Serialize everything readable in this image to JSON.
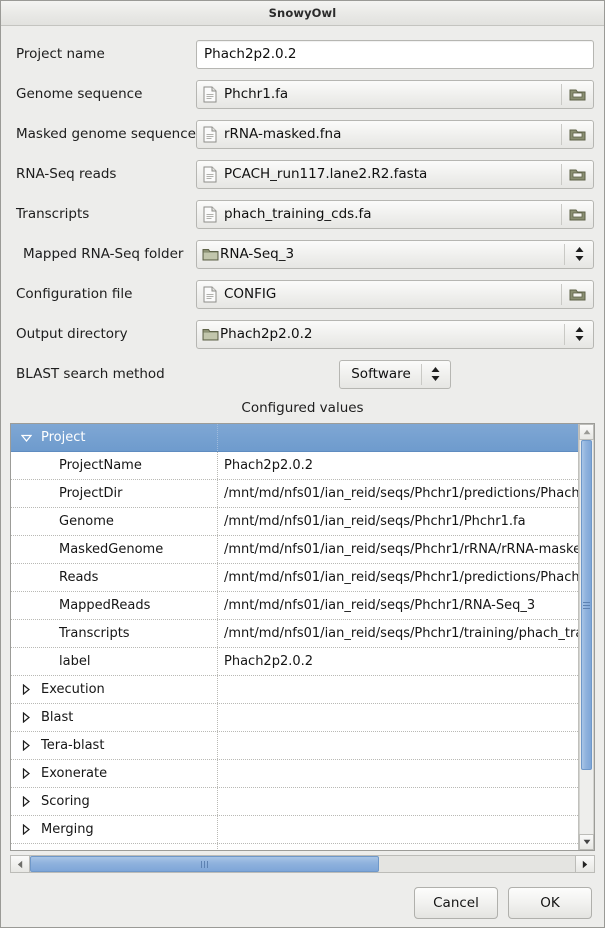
{
  "window": {
    "title": "SnowyOwl"
  },
  "form": {
    "rows": [
      {
        "label": "Project name",
        "type": "entry",
        "value": "Phach2p2.0.2",
        "icon": "",
        "name": "project-name"
      },
      {
        "label": "Genome sequence",
        "type": "file",
        "value": "Phchr1.fa",
        "icon": "file-icon",
        "button_icon": "open-folder-icon",
        "name": "genome-sequence"
      },
      {
        "label": "Masked genome sequence",
        "type": "file",
        "value": "rRNA-masked.fna",
        "icon": "file-icon",
        "button_icon": "open-folder-icon",
        "name": "masked-genome-sequence"
      },
      {
        "label": "RNA-Seq reads",
        "type": "file",
        "value": "PCACH_run117.lane2.R2.fasta",
        "icon": "file-icon",
        "button_icon": "open-folder-icon",
        "name": "rna-seq-reads"
      },
      {
        "label": "Transcripts",
        "type": "file",
        "value": "phach_training_cds.fa",
        "icon": "file-icon",
        "button_icon": "open-folder-icon",
        "name": "transcripts"
      },
      {
        "label": "Mapped RNA-Seq folder",
        "type": "folder-combo",
        "value": "RNA-Seq_3",
        "icon": "folder-icon",
        "button_icon": "updown-chevron-icon",
        "name": "mapped-rna-seq-folder"
      },
      {
        "label": "Configuration file",
        "type": "file",
        "value": "CONFIG",
        "icon": "file-icon",
        "button_icon": "open-folder-icon",
        "name": "configuration-file"
      },
      {
        "label": "Output directory",
        "type": "folder-combo",
        "value": "Phach2p2.0.2",
        "icon": "folder-icon",
        "button_icon": "updown-chevron-icon",
        "name": "output-directory"
      },
      {
        "label": "BLAST search method",
        "type": "combo",
        "value": "Software",
        "icon": "",
        "button_icon": "updown-chevron-icon",
        "name": "blast-search-method"
      }
    ]
  },
  "configured_values": {
    "title": "Configured values",
    "rows": [
      {
        "kind": "group",
        "expanded": true,
        "selected": true,
        "name": "Project",
        "value": ""
      },
      {
        "kind": "leaf",
        "name": "ProjectName",
        "value": "Phach2p2.0.2"
      },
      {
        "kind": "leaf",
        "name": "ProjectDir",
        "value": "/mnt/md/nfs01/ian_reid/seqs/Phchr1/predictions/Phach"
      },
      {
        "kind": "leaf",
        "name": "Genome",
        "value": "/mnt/md/nfs01/ian_reid/seqs/Phchr1/Phchr1.fa"
      },
      {
        "kind": "leaf",
        "name": "MaskedGenome",
        "value": "/mnt/md/nfs01/ian_reid/seqs/Phchr1/rRNA/rRNA-maske"
      },
      {
        "kind": "leaf",
        "name": "Reads",
        "value": "/mnt/md/nfs01/ian_reid/seqs/Phchr1/predictions/Phach"
      },
      {
        "kind": "leaf",
        "name": "MappedReads",
        "value": "/mnt/md/nfs01/ian_reid/seqs/Phchr1/RNA-Seq_3"
      },
      {
        "kind": "leaf",
        "name": "Transcripts",
        "value": "/mnt/md/nfs01/ian_reid/seqs/Phchr1/training/phach_tra"
      },
      {
        "kind": "leaf",
        "name": "label",
        "value": "Phach2p2.0.2"
      },
      {
        "kind": "group",
        "expanded": false,
        "selected": false,
        "name": "Execution",
        "value": ""
      },
      {
        "kind": "group",
        "expanded": false,
        "selected": false,
        "name": "Blast",
        "value": ""
      },
      {
        "kind": "group",
        "expanded": false,
        "selected": false,
        "name": "Tera-blast",
        "value": ""
      },
      {
        "kind": "group",
        "expanded": false,
        "selected": false,
        "name": "Exonerate",
        "value": ""
      },
      {
        "kind": "group",
        "expanded": false,
        "selected": false,
        "name": "Scoring",
        "value": ""
      },
      {
        "kind": "group",
        "expanded": false,
        "selected": false,
        "name": "Merging",
        "value": ""
      },
      {
        "kind": "group",
        "expanded": false,
        "selected": false,
        "name": "",
        "value": ""
      }
    ]
  },
  "actions": {
    "cancel_label": "Cancel",
    "ok_label": "OK"
  },
  "colors": {
    "selection_blue": "#7fa7d4",
    "scrollbar_blue": "#8fb2dd",
    "window_bg": "#ededeb"
  }
}
